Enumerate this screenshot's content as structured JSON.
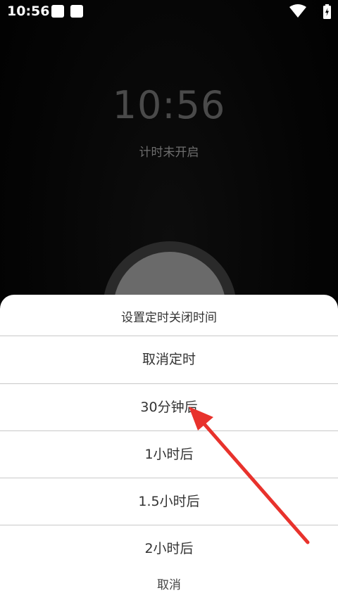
{
  "status_bar": {
    "time": "10:56",
    "icons": [
      "notification-icon",
      "notification-icon",
      "wifi-icon",
      "battery-charging-icon"
    ]
  },
  "clock": {
    "time": "10:56",
    "timer_status": "计时未开启"
  },
  "sheet": {
    "title": "设置定时关闭时间",
    "options": [
      "取消定时",
      "30分钟后",
      "1小时后",
      "1.5小时后",
      "2小时后"
    ],
    "cancel_label": "取消"
  },
  "colors": {
    "background": "#000000",
    "sheet_background": "#ffffff",
    "clock_text": "#4a4a4a",
    "annotation_arrow": "#e8322c"
  }
}
